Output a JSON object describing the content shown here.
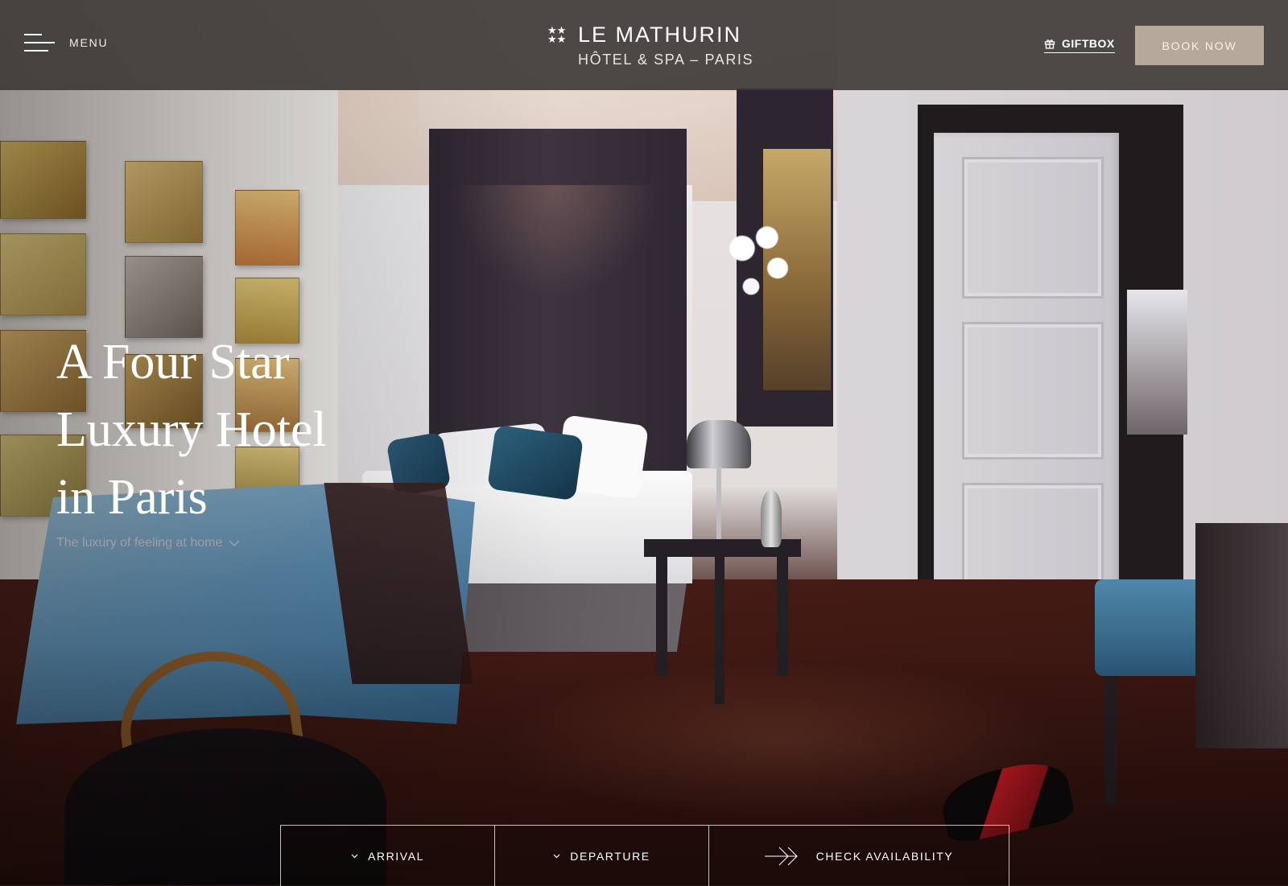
{
  "header": {
    "menu_label": "MENU",
    "logo": {
      "stars": "★★\n★★",
      "name": "LE MATHURIN",
      "tagline": "HÔTEL & SPA – PARIS"
    },
    "giftbox_label": "GIFTBOX",
    "book_now_label": "BOOK NOW"
  },
  "hero": {
    "title_lines": [
      "A Four Star",
      "Luxury Hotel",
      "in Paris"
    ],
    "subtitle": "The luxury of feeling at home"
  },
  "booking": {
    "arrival_label": "ARRIVAL",
    "departure_label": "DEPARTURE",
    "check_label": "CHECK AVAILABILITY"
  },
  "colors": {
    "header_bg": "#3c3735",
    "book_now_bg": "#b6a89a",
    "text_light": "#ffffff"
  },
  "icons": [
    "hamburger-icon",
    "gift-icon",
    "chevron-down-icon",
    "arrow-right-icon"
  ]
}
